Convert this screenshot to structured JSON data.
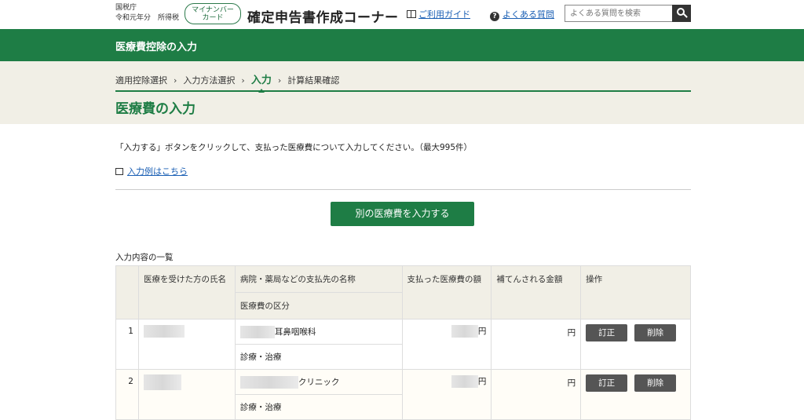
{
  "header": {
    "agency_line1": "国税庁",
    "agency_line2": "令和元年分　所得税",
    "mynumber_line1": "マイナンバー",
    "mynumber_line2": "カード",
    "site_title": "確定申告書作成コーナー",
    "guide_label": "ご利用ガイド",
    "faq_label": "よくある質問",
    "search_placeholder": "よくある質問を検索"
  },
  "band": {
    "title": "医療費控除の入力"
  },
  "breadcrumb": {
    "steps": [
      "適用控除選択",
      "入力方法選択",
      "入力",
      "計算結果確認"
    ]
  },
  "page": {
    "title": "医療費の入力",
    "instruction": "「入力する」ボタンをクリックして、支払った医療費について入力してください。（最大995件）",
    "example_link": "入力例はこちら",
    "add_button": "別の医療費を入力する",
    "list_caption": "入力内容の一覧"
  },
  "table": {
    "headers": {
      "name": "医療を受けた方の氏名",
      "payee": "病院・薬局などの支払先の名称",
      "category": "医療費の区分",
      "paid": "支払った医療費の額",
      "compensated": "補てんされる金額",
      "action": "操作"
    },
    "rows": [
      {
        "index": "1",
        "payee_suffix": "耳鼻咽喉科",
        "category": "診療・治療",
        "paid_unit": "円",
        "comp_unit": "円",
        "edit": "訂正",
        "delete": "削除"
      },
      {
        "index": "2",
        "payee_suffix": "クリニック",
        "category": "診療・治療",
        "paid_unit": "円",
        "comp_unit": "円",
        "edit": "訂正",
        "delete": "削除"
      }
    ]
  }
}
